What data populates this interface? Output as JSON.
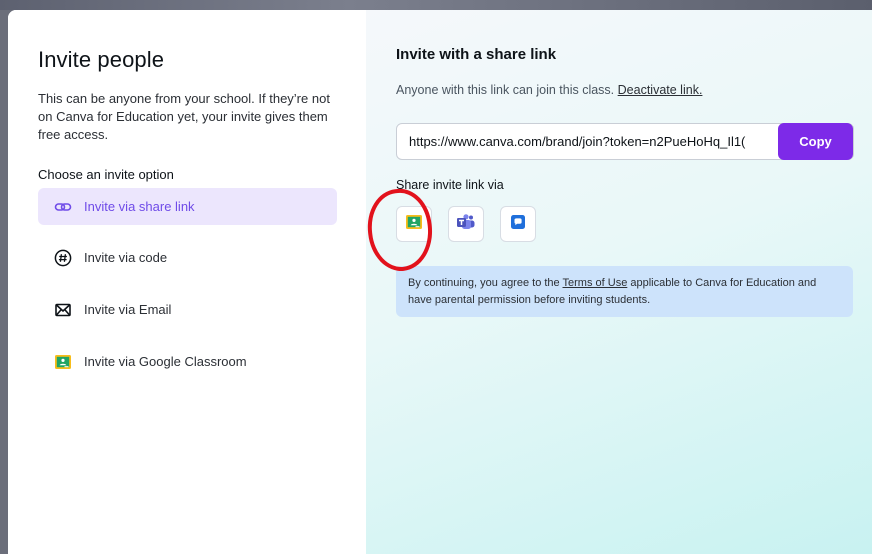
{
  "left": {
    "title": "Invite people",
    "description": "This can be anyone from your school. If they’re not on Canva for Education yet, your invite gives them free access.",
    "choose_heading": "Choose an invite option",
    "options": [
      {
        "label": "Invite via share link",
        "icon": "link-icon",
        "active": true
      },
      {
        "label": "Invite via code",
        "icon": "hashtag-icon",
        "active": false
      },
      {
        "label": "Invite via Email",
        "icon": "envelope-icon",
        "active": false
      },
      {
        "label": "Invite via Google Classroom",
        "icon": "google-classroom-icon",
        "active": false
      }
    ]
  },
  "right": {
    "title": "Invite with a share link",
    "description": "Anyone with this link can join this class.",
    "deactivate_label": "Deactivate link.",
    "link_value": "https://www.canva.com/brand/join?token=n2PueHoHq_Il1(",
    "copy_label": "Copy",
    "share_via_label": "Share invite link via",
    "share_buttons": [
      {
        "icon": "google-classroom-icon"
      },
      {
        "icon": "microsoft-teams-icon"
      },
      {
        "icon": "chat-icon"
      }
    ],
    "notice": {
      "prefix": "By continuing, you agree to the ",
      "tos_label": "Terms of Use",
      "suffix": " applicable to Canva for Education and have parental permission before inviting students."
    }
  },
  "colors": {
    "accent": "#7d2ae8",
    "active_option_bg": "#ece6fd",
    "active_option_text": "#6f4be8",
    "notice_bg": "#cde3fb",
    "annotation_circle": "#e2121c"
  }
}
